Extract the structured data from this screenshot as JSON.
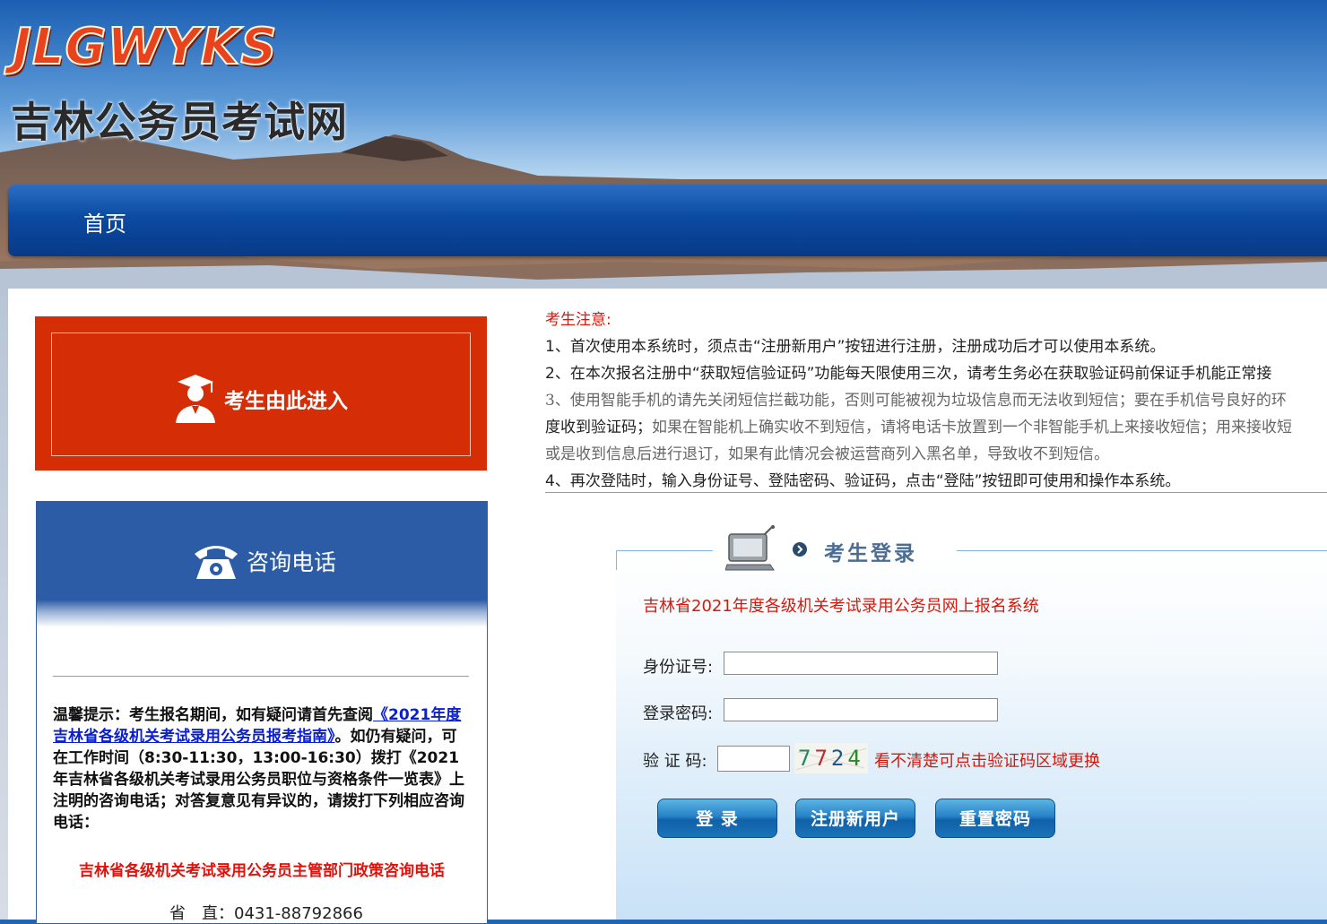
{
  "site": {
    "logo_en": "JLGWYKS",
    "logo_cn": "吉林公务员考试网"
  },
  "nav": {
    "home": "首页"
  },
  "left": {
    "enter_label": "考生由此进入",
    "consult_title": "咨询电话",
    "tips_prefix": "温馨提示：考生报名期间，如有疑问请首先查阅",
    "tips_link": "《2021年度吉林省各级机关考试录用公务员报考指南》",
    "tips_suffix": "。如仍有疑问，可在工作时间（8:30-11:30，13:00-16:30）拨打《2021年吉林省各级机关考试录用公务员职位与资格条件一览表》上注明的咨询电话；对答复意见有异议的，请拨打下列相应咨询电话：",
    "dept_title": "吉林省各级机关考试录用公务员主管部门政策咨询电话",
    "prov_label": "省　直：",
    "prov_phone": "0431-88792866"
  },
  "notice": {
    "title": "考生注意:",
    "item1": "1、首次使用本系统时，须点击“注册新用户”按钮进行注册，注册成功后才可以使用本系统。",
    "item2": "2、在本次报名注册中“获取短信验证码”功能每天限使用三次，请考生务必在获取验证码前保证手机能正常接",
    "item3a": "3、使用智能手机的请先关闭短信拦截功能，否则可能被视为垃圾信息而无法收到短信；要在手机信号良好的环",
    "item3b_lead": "度收到验证码；",
    "item3b_rest": "如果在智能机上确实收不到短信，请将电话卡放置到一个非智能手机上来接收短信；用来接收短",
    "item3c": "或是收到信息后进行退订，如果有此情况会被运营商列入黑名单，导致收不到短信。",
    "item4": "4、再次登陆时，输入身份证号、登陆密码、验证码，点击“登陆”按钮即可使用和操作本系统。"
  },
  "login": {
    "title": "考生登录",
    "system_title": "吉林省2021年度各级机关考试录用公务员网上报名系统",
    "id_label": "身份证号:",
    "id_value": "",
    "pwd_label": "登录密码:",
    "pwd_value": "",
    "code_label": "验 证 码:",
    "code_value": "",
    "captcha_text": "7724",
    "captcha_tip": "看不清楚可点击验证码区域更换",
    "login_btn": "登 录",
    "register_btn": "注册新用户",
    "reset_btn": "重置密码"
  },
  "colors": {
    "accent_red": "#d21a0c",
    "nav_blue": "#0c4aa2",
    "enter_orange": "#d52d06",
    "consult_blue": "#2c5ca6"
  }
}
